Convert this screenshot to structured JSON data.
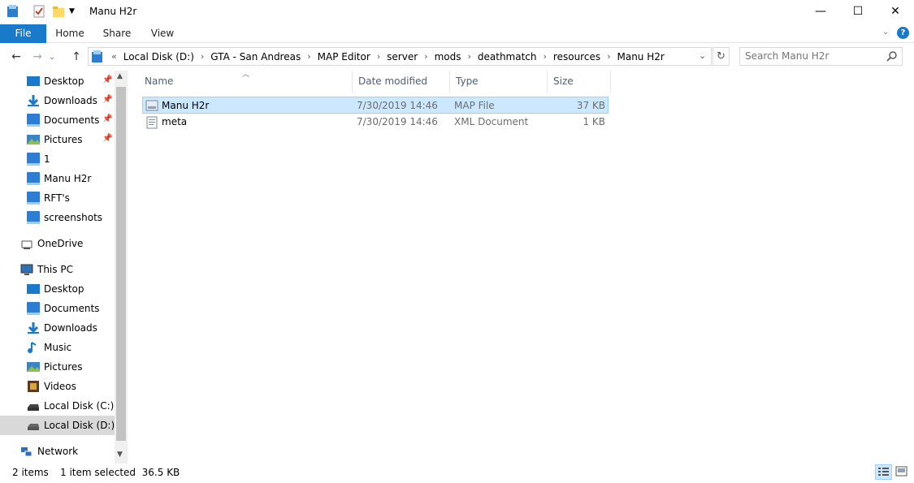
{
  "window": {
    "title": "Manu H2r",
    "minimize": "—",
    "maximize": "☐",
    "close": "✕"
  },
  "ribbon": {
    "tabs": [
      "File",
      "Home",
      "Share",
      "View"
    ]
  },
  "nav": {
    "back": "←",
    "forward": "→",
    "recent": "⌄",
    "up": "↑"
  },
  "address": {
    "overflow": "«",
    "crumbs": [
      "Local Disk (D:)",
      "GTA - San Andreas",
      "MAP Editor",
      "server",
      "mods",
      "deathmatch",
      "resources",
      "Manu H2r"
    ],
    "separator": "›"
  },
  "search": {
    "placeholder": "Search Manu H2r"
  },
  "sidebar": {
    "quick_access": [
      "Desktop",
      "Downloads",
      "Documents",
      "Pictures",
      "1",
      "Manu H2r",
      "RFT's",
      "screenshots"
    ],
    "onedrive": "OneDrive",
    "this_pc": "This PC",
    "this_pc_items": [
      "Desktop",
      "Documents",
      "Downloads",
      "Music",
      "Pictures",
      "Videos",
      "Local Disk (C:)",
      "Local Disk (D:)"
    ],
    "network": "Network"
  },
  "columns": {
    "name": "Name",
    "date": "Date modified",
    "type": "Type",
    "size": "Size"
  },
  "files": [
    {
      "name": "Manu H2r",
      "date": "7/30/2019 14:46",
      "type": "MAP File",
      "size": "37 KB"
    },
    {
      "name": "meta",
      "date": "7/30/2019 14:46",
      "type": "XML Document",
      "size": "1 KB"
    }
  ],
  "status": {
    "items": "2 items",
    "selected": "1 item selected  36.5 KB"
  },
  "colors": {
    "accent": "#1979ca",
    "selection": "#cce8ff",
    "selection_border": "#99d1ff"
  }
}
